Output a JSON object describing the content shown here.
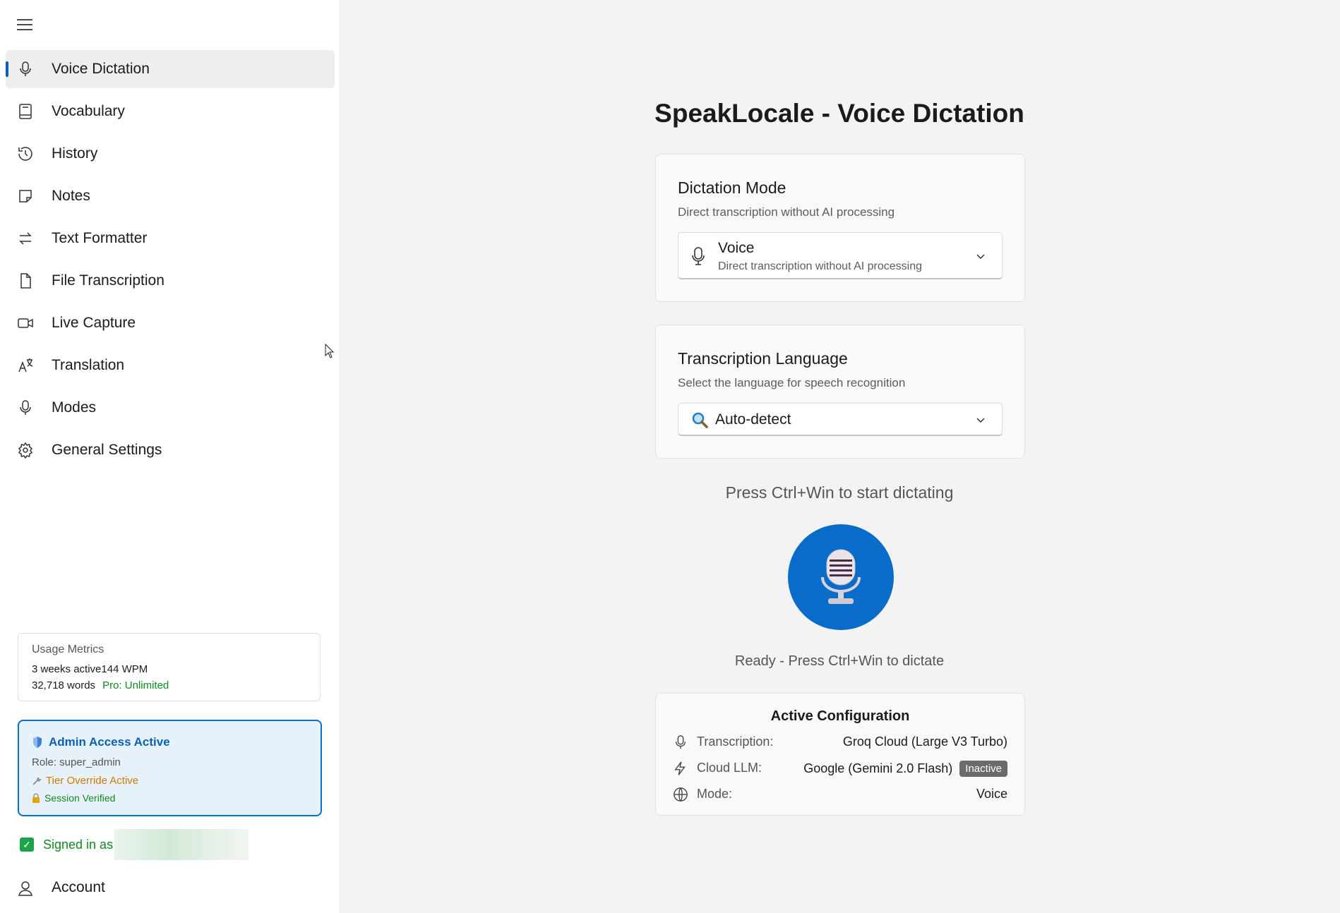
{
  "sidebar": {
    "items": [
      {
        "label": "Voice Dictation",
        "icon": "microphone-icon"
      },
      {
        "label": "Vocabulary",
        "icon": "book-icon"
      },
      {
        "label": "History",
        "icon": "history-icon"
      },
      {
        "label": "Notes",
        "icon": "sticky-note-icon"
      },
      {
        "label": "Text Formatter",
        "icon": "arrows-swap-icon"
      },
      {
        "label": "File Transcription",
        "icon": "document-icon"
      },
      {
        "label": "Live Capture",
        "icon": "video-camera-icon"
      },
      {
        "label": "Translation",
        "icon": "translate-icon"
      },
      {
        "label": "Modes",
        "icon": "microphone-icon"
      },
      {
        "label": "General Settings",
        "icon": "gear-icon"
      }
    ],
    "active_item": "Voice Dictation",
    "metrics": {
      "title": "Usage Metrics",
      "line1": "3 weeks active144 WPM",
      "words": "32,718 words",
      "plan": "Pro: Unlimited"
    },
    "admin": {
      "title": "Admin Access Active",
      "role": "Role: super_admin",
      "tier": "Tier Override Active",
      "session": "Session Verified"
    },
    "signed_in": "Signed in as",
    "account": "Account"
  },
  "main": {
    "title": "SpeakLocale - Voice Dictation",
    "dictation_mode": {
      "title": "Dictation Mode",
      "description": "Direct transcription without AI processing",
      "selected_label": "Voice",
      "selected_description": "Direct transcription without AI processing"
    },
    "language": {
      "title": "Transcription Language",
      "description": "Select the language for speech recognition",
      "selected": "Auto-detect"
    },
    "prompt": "Press Ctrl+Win to start dictating",
    "status": "Ready - Press Ctrl+Win to dictate",
    "config": {
      "title": "Active Configuration",
      "rows": [
        {
          "key": "Transcription:",
          "value": "Groq Cloud (Large V3 Turbo)",
          "icon": "microphone-icon"
        },
        {
          "key": "Cloud LLM:",
          "value": "Google (Gemini 2.0 Flash)",
          "badge": "Inactive",
          "icon": "lightning-icon"
        },
        {
          "key": "Mode:",
          "value": "Voice",
          "icon": "globe-icon"
        }
      ]
    }
  },
  "colors": {
    "accent": "#0a60b8",
    "mic_button": "#0a6cc9",
    "success": "#0f8a1f",
    "warning": "#d07a00"
  }
}
